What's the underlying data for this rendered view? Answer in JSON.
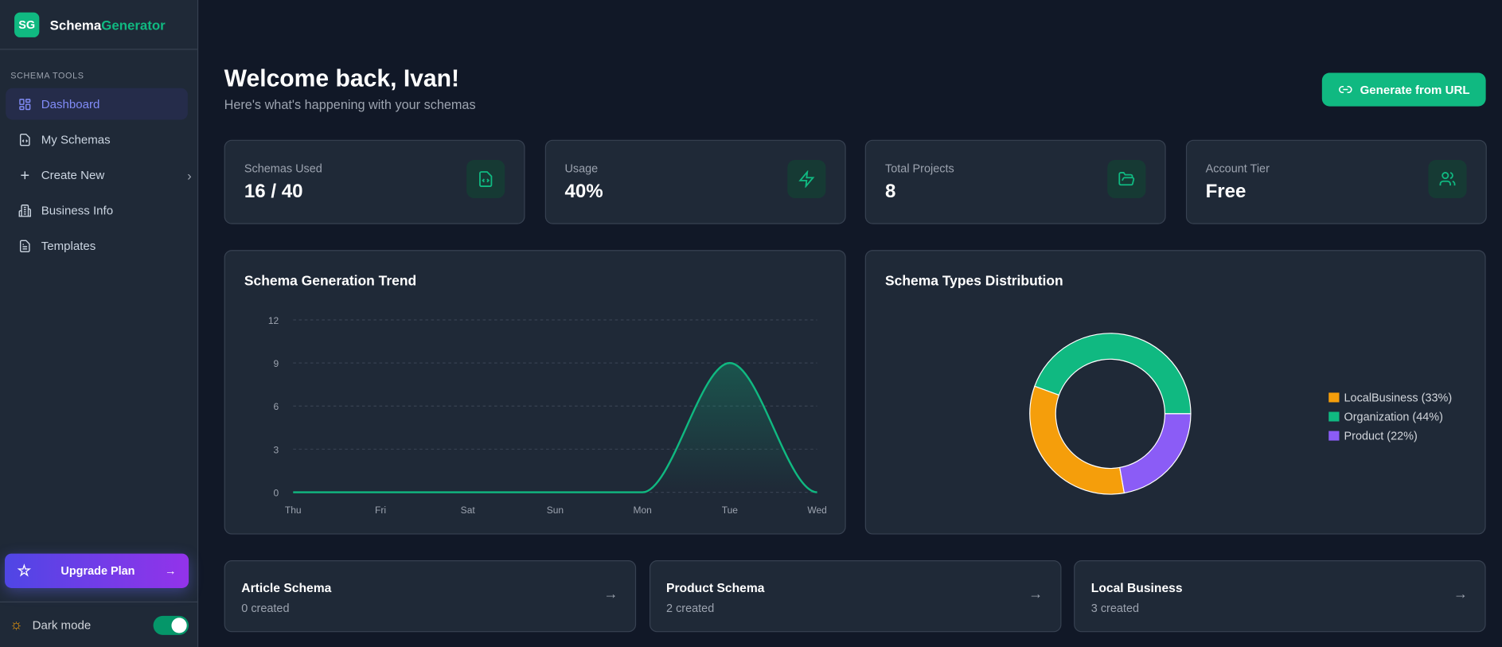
{
  "brand": {
    "badge": "SG",
    "name_a": "Schema",
    "name_b": "Generator"
  },
  "sidebar": {
    "section": "SCHEMA TOOLS",
    "items": [
      {
        "label": "Dashboard",
        "icon": "dashboard-icon"
      },
      {
        "label": "My Schemas",
        "icon": "file-code-icon"
      },
      {
        "label": "Create New",
        "icon": "plus-icon"
      },
      {
        "label": "Business Info",
        "icon": "building-icon"
      },
      {
        "label": "Templates",
        "icon": "file-text-icon"
      }
    ],
    "upgrade": "Upgrade Plan",
    "dark_mode": "Dark mode",
    "dark_mode_on": true
  },
  "header": {
    "title": "Welcome back, Ivan!",
    "subtitle": "Here's what's happening with your schemas",
    "button": "Generate from URL"
  },
  "stats": [
    {
      "label": "Schemas Used",
      "value": "16 / 40",
      "icon": "file-code-icon"
    },
    {
      "label": "Usage",
      "value": "40%",
      "icon": "zap-icon"
    },
    {
      "label": "Total Projects",
      "value": "8",
      "icon": "folder-open-icon"
    },
    {
      "label": "Account Tier",
      "value": "Free",
      "icon": "users-icon"
    }
  ],
  "chart_data": [
    {
      "type": "area",
      "title": "Schema Generation Trend",
      "categories": [
        "Thu",
        "Fri",
        "Sat",
        "Sun",
        "Mon",
        "Tue",
        "Wed"
      ],
      "values": [
        0,
        0,
        0,
        0,
        0,
        9,
        0
      ],
      "yticks": [
        "0",
        "3",
        "6",
        "9",
        "12"
      ],
      "ylim": [
        0,
        12
      ],
      "grid": true,
      "color": "#10b981"
    },
    {
      "type": "pie",
      "title": "Schema Types Distribution",
      "donut": true,
      "legend_position": "right",
      "slices": [
        {
          "name": "Organization",
          "value": 44,
          "label": "Organization (44%)",
          "color": "#10b981"
        },
        {
          "name": "LocalBusiness",
          "value": 33,
          "label": "LocalBusiness (33%)",
          "color": "#f59e0b"
        },
        {
          "name": "Product",
          "value": 22,
          "label": "Product (22%)",
          "color": "#8b5cf6"
        }
      ]
    }
  ],
  "quick": [
    {
      "title": "Article Schema",
      "sub": "0 created"
    },
    {
      "title": "Product Schema",
      "sub": "2 created"
    },
    {
      "title": "Local Business",
      "sub": "3 created"
    }
  ]
}
